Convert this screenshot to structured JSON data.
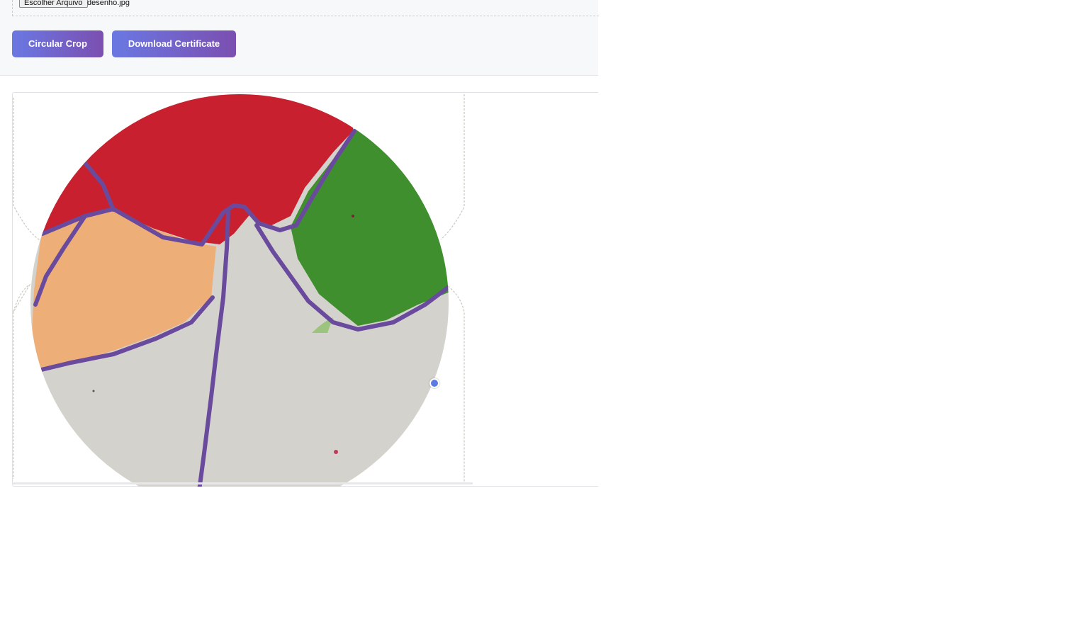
{
  "upload": {
    "button_label": "Escolher Arquivo",
    "file_name": "desenho.jpg"
  },
  "toolbar": {
    "crop_label": "Circular Crop",
    "download_label": "Download Certificate"
  },
  "colors": {
    "button_gradient_start": "#6a78e3",
    "button_gradient_end": "#7b4fb0",
    "handle": "#5b7be0"
  },
  "canvas": {
    "image_description_icon": "crayon-drawing",
    "crop_shape": "circle"
  }
}
